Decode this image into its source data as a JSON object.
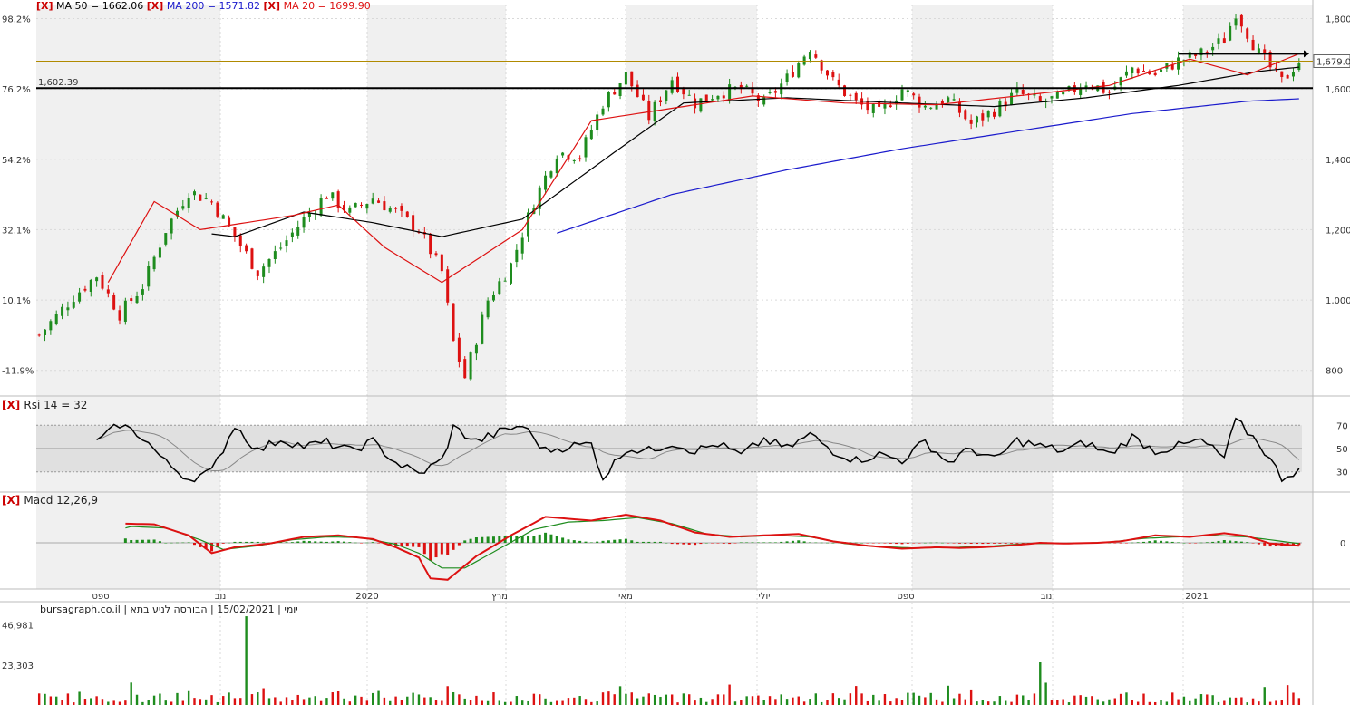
{
  "legend": {
    "x_mark": "[X]",
    "ma50": "MA 50 = 1662.06",
    "ma200": "MA 200 = 1571.82",
    "ma20": "MA 20 = 1699.90",
    "ma50_color": "#000000",
    "ma200_color": "#1a1acc",
    "ma20_color": "#dd1111"
  },
  "rsi_title": "Rsi 14 = 32",
  "macd_title": "Macd 12,26,9",
  "volume_note": "יומי | 15/02/2021 | הבורסה לניע בתא | bursagraph.co.il",
  "price_marker": "1,679.00",
  "support_label": "1,602.39",
  "colors": {
    "up": "#1e8c1e",
    "down": "#dd1111",
    "grid": "#d9d9d9",
    "shade": "#f0f0f0"
  },
  "chart_data": {
    "type": "candlestick",
    "price_axis": {
      "ticks": [
        "1,800",
        "1,600",
        "1,400",
        "1,200",
        "1,000",
        "800"
      ],
      "values": [
        1800,
        1600,
        1400,
        1200,
        1000,
        800
      ],
      "range": [
        740,
        1840
      ]
    },
    "pct_axis": {
      "ticks": [
        "98.2%",
        "76.2%",
        "54.2%",
        "32.1%",
        "10.1%",
        "-11.9%"
      ]
    },
    "x_ticks": [
      "ספט",
      "נוב",
      "2020",
      "מרץ",
      "מאי",
      "יולי",
      "ספט",
      "נוב",
      "2021"
    ],
    "horizontal_lines": [
      {
        "label": "1,602.39",
        "value": 1602.39,
        "color": "#000000"
      },
      {
        "label": "",
        "value": 1679,
        "color": "#b08a00"
      }
    ],
    "ma_anchors": {
      "ma20": [
        [
          0,
          1080
        ],
        [
          12,
          1050
        ],
        [
          20,
          1280
        ],
        [
          28,
          1200
        ],
        [
          44,
          1240
        ],
        [
          52,
          1270
        ],
        [
          60,
          1150
        ],
        [
          70,
          1050
        ],
        [
          84,
          1200
        ],
        [
          96,
          1510
        ],
        [
          108,
          1540
        ],
        [
          124,
          1580
        ],
        [
          140,
          1560
        ],
        [
          156,
          1555
        ],
        [
          170,
          1580
        ],
        [
          186,
          1610
        ],
        [
          200,
          1685
        ],
        [
          210,
          1640
        ],
        [
          219,
          1700
        ]
      ],
      "ma50": [
        [
          0,
          1040
        ],
        [
          14,
          1130
        ],
        [
          24,
          1200
        ],
        [
          34,
          1180
        ],
        [
          46,
          1250
        ],
        [
          58,
          1220
        ],
        [
          70,
          1180
        ],
        [
          84,
          1230
        ],
        [
          100,
          1420
        ],
        [
          112,
          1560
        ],
        [
          130,
          1575
        ],
        [
          150,
          1560
        ],
        [
          166,
          1550
        ],
        [
          182,
          1575
        ],
        [
          198,
          1610
        ],
        [
          212,
          1650
        ],
        [
          219,
          1662
        ]
      ],
      "ma200": [
        [
          90,
          1190
        ],
        [
          110,
          1300
        ],
        [
          130,
          1370
        ],
        [
          150,
          1430
        ],
        [
          170,
          1480
        ],
        [
          190,
          1530
        ],
        [
          210,
          1565
        ],
        [
          219,
          1572
        ]
      ]
    },
    "price_anchors": [
      [
        0,
        900
      ],
      [
        6,
        1010
      ],
      [
        10,
        1070
      ],
      [
        14,
        960
      ],
      [
        18,
        1040
      ],
      [
        22,
        1200
      ],
      [
        26,
        1310
      ],
      [
        30,
        1280
      ],
      [
        34,
        1180
      ],
      [
        38,
        1080
      ],
      [
        42,
        1150
      ],
      [
        46,
        1230
      ],
      [
        50,
        1300
      ],
      [
        54,
        1250
      ],
      [
        58,
        1290
      ],
      [
        62,
        1250
      ],
      [
        66,
        1200
      ],
      [
        70,
        1080
      ],
      [
        72,
        880
      ],
      [
        74,
        780
      ],
      [
        78,
        1000
      ],
      [
        82,
        1100
      ],
      [
        86,
        1280
      ],
      [
        90,
        1420
      ],
      [
        94,
        1410
      ],
      [
        98,
        1560
      ],
      [
        102,
        1640
      ],
      [
        106,
        1520
      ],
      [
        110,
        1630
      ],
      [
        114,
        1560
      ],
      [
        118,
        1590
      ],
      [
        122,
        1600
      ],
      [
        126,
        1560
      ],
      [
        130,
        1630
      ],
      [
        134,
        1720
      ],
      [
        138,
        1620
      ],
      [
        142,
        1560
      ],
      [
        146,
        1530
      ],
      [
        150,
        1600
      ],
      [
        154,
        1550
      ],
      [
        158,
        1570
      ],
      [
        162,
        1500
      ],
      [
        166,
        1540
      ],
      [
        170,
        1590
      ],
      [
        174,
        1560
      ],
      [
        178,
        1580
      ],
      [
        182,
        1620
      ],
      [
        186,
        1590
      ],
      [
        190,
        1660
      ],
      [
        194,
        1640
      ],
      [
        198,
        1680
      ],
      [
        202,
        1700
      ],
      [
        206,
        1740
      ],
      [
        208,
        1820
      ],
      [
        212,
        1700
      ],
      [
        216,
        1620
      ],
      [
        219,
        1680
      ]
    ],
    "rsi": {
      "levels": [
        70,
        50,
        30
      ],
      "range": [
        15,
        85
      ],
      "anchors": [
        [
          0,
          62
        ],
        [
          6,
          32
        ],
        [
          10,
          55
        ],
        [
          14,
          71
        ],
        [
          18,
          60
        ],
        [
          22,
          38
        ],
        [
          26,
          24
        ],
        [
          30,
          30
        ],
        [
          34,
          70
        ],
        [
          38,
          48
        ],
        [
          42,
          58
        ],
        [
          46,
          52
        ],
        [
          50,
          55
        ],
        [
          54,
          48
        ],
        [
          58,
          56
        ],
        [
          62,
          38
        ],
        [
          66,
          28
        ],
        [
          70,
          40
        ],
        [
          72,
          68
        ],
        [
          76,
          56
        ],
        [
          80,
          64
        ],
        [
          84,
          70
        ],
        [
          88,
          48
        ],
        [
          92,
          52
        ],
        [
          96,
          54
        ],
        [
          98,
          25
        ],
        [
          102,
          50
        ],
        [
          106,
          48
        ],
        [
          110,
          55
        ],
        [
          114,
          48
        ],
        [
          118,
          54
        ],
        [
          122,
          44
        ],
        [
          126,
          58
        ],
        [
          130,
          50
        ],
        [
          134,
          62
        ],
        [
          138,
          48
        ],
        [
          142,
          40
        ],
        [
          146,
          45
        ],
        [
          150,
          40
        ],
        [
          154,
          56
        ],
        [
          158,
          38
        ],
        [
          162,
          50
        ],
        [
          166,
          40
        ],
        [
          170,
          57
        ],
        [
          174,
          52
        ],
        [
          178,
          48
        ],
        [
          182,
          55
        ],
        [
          186,
          45
        ],
        [
          190,
          60
        ],
        [
          194,
          48
        ],
        [
          198,
          52
        ],
        [
          202,
          57
        ],
        [
          206,
          42
        ],
        [
          208,
          74
        ],
        [
          212,
          55
        ],
        [
          216,
          25
        ],
        [
          219,
          32
        ]
      ]
    },
    "macd": {
      "range": [
        -60,
        60
      ],
      "macd_anchors": [
        [
          0,
          0
        ],
        [
          6,
          3
        ],
        [
          14,
          26
        ],
        [
          20,
          25
        ],
        [
          26,
          10
        ],
        [
          30,
          -14
        ],
        [
          34,
          -6
        ],
        [
          40,
          -1
        ],
        [
          46,
          8
        ],
        [
          52,
          10
        ],
        [
          58,
          5
        ],
        [
          62,
          -6
        ],
        [
          66,
          -20
        ],
        [
          68,
          -48
        ],
        [
          71,
          -50
        ],
        [
          76,
          -18
        ],
        [
          82,
          10
        ],
        [
          88,
          35
        ],
        [
          96,
          30
        ],
        [
          102,
          38
        ],
        [
          108,
          30
        ],
        [
          114,
          14
        ],
        [
          120,
          8
        ],
        [
          126,
          10
        ],
        [
          132,
          12
        ],
        [
          138,
          2
        ],
        [
          144,
          -4
        ],
        [
          150,
          -8
        ],
        [
          156,
          -6
        ],
        [
          160,
          -7
        ],
        [
          164,
          -6
        ],
        [
          170,
          -3
        ],
        [
          174,
          0
        ],
        [
          178,
          -1
        ],
        [
          184,
          0
        ],
        [
          188,
          2
        ],
        [
          194,
          10
        ],
        [
          200,
          8
        ],
        [
          206,
          13
        ],
        [
          210,
          9
        ],
        [
          214,
          -1
        ],
        [
          219,
          -4
        ]
      ],
      "signal_anchors": [
        [
          0,
          0
        ],
        [
          8,
          6
        ],
        [
          16,
          22
        ],
        [
          22,
          20
        ],
        [
          28,
          4
        ],
        [
          32,
          -9
        ],
        [
          38,
          -4
        ],
        [
          44,
          4
        ],
        [
          50,
          8
        ],
        [
          56,
          7
        ],
        [
          62,
          -2
        ],
        [
          66,
          -14
        ],
        [
          70,
          -34
        ],
        [
          74,
          -34
        ],
        [
          80,
          -8
        ],
        [
          86,
          18
        ],
        [
          92,
          28
        ],
        [
          98,
          30
        ],
        [
          104,
          34
        ],
        [
          110,
          26
        ],
        [
          116,
          12
        ],
        [
          122,
          8
        ],
        [
          128,
          10
        ],
        [
          134,
          8
        ],
        [
          140,
          -1
        ],
        [
          146,
          -5
        ],
        [
          152,
          -7
        ],
        [
          160,
          -6
        ],
        [
          166,
          -4
        ],
        [
          172,
          -1
        ],
        [
          180,
          -1
        ],
        [
          186,
          1
        ],
        [
          192,
          6
        ],
        [
          198,
          8
        ],
        [
          204,
          10
        ],
        [
          210,
          8
        ],
        [
          216,
          2
        ],
        [
          219,
          -1
        ]
      ]
    },
    "volume": {
      "ticks": [
        "46,981",
        "23,303"
      ],
      "values": [
        46981,
        23303
      ],
      "spike_index": 36,
      "spike_value": 52000,
      "second_spike_index": 174,
      "second_spike_value": 25000
    }
  }
}
